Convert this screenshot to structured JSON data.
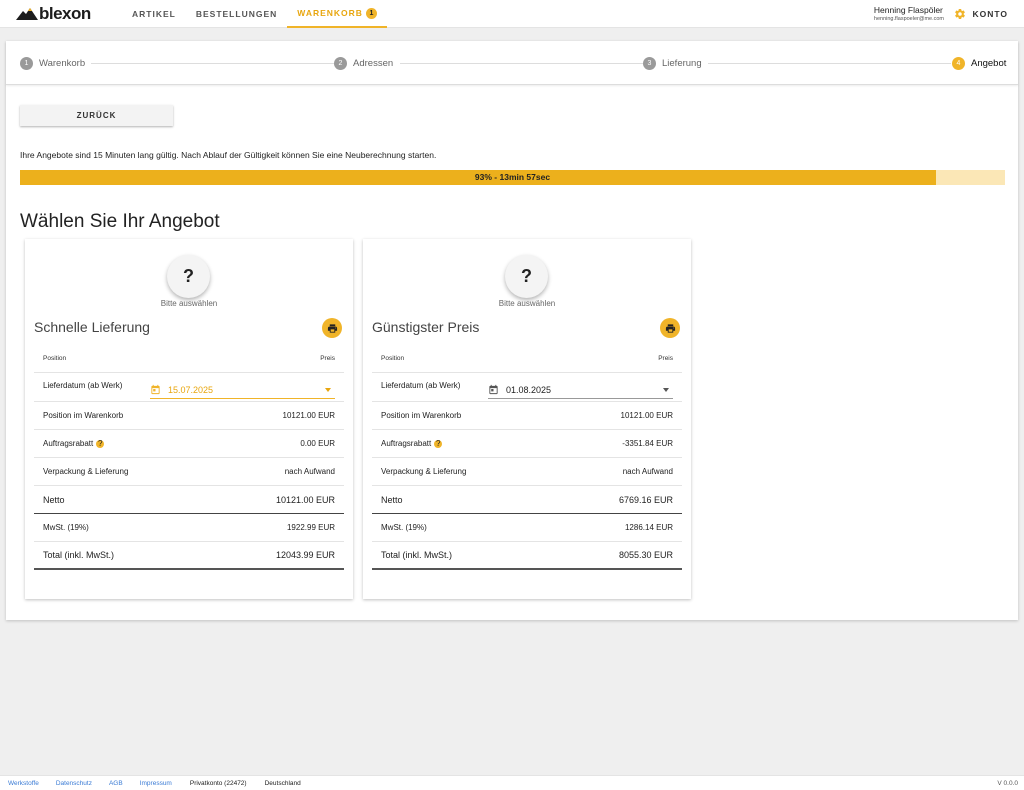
{
  "logo": {
    "text": "blexon"
  },
  "nav": {
    "items": [
      {
        "label": "ARTIKEL"
      },
      {
        "label": "BESTELLUNGEN"
      },
      {
        "label": "WARENKORB",
        "badge": "1"
      }
    ]
  },
  "user": {
    "name": "Henning Flaspöler",
    "email": "henning.flaspoeler@me.com"
  },
  "account": {
    "label": "KONTO",
    "icon": "gear-icon"
  },
  "stepper": {
    "steps": [
      {
        "num": "1",
        "label": "Warenkorb"
      },
      {
        "num": "2",
        "label": "Adressen"
      },
      {
        "num": "3",
        "label": "Lieferung"
      },
      {
        "num": "4",
        "label": "Angebot"
      }
    ],
    "active_step": "4"
  },
  "back_button": {
    "label": "ZURÜCK"
  },
  "info_text": "Ihre Angebote sind 15 Minuten lang gültig. Nach Ablauf der Gültigkeit können Sie eine Neuberechnung starten.",
  "progress": {
    "percent": 93,
    "text": "93% - 13min 57sec"
  },
  "heading": "Wählen Sie Ihr Angebot",
  "offers": [
    {
      "select_symbol": "?",
      "select_label": "Bitte auswählen",
      "title": "Schnelle Lieferung",
      "header_position": "Position",
      "header_price": "Preis",
      "delivery_date_label": "Lieferdatum (ab Werk)",
      "delivery_date": "15.07.2025",
      "rows": [
        {
          "label": "Position im Warenkorb",
          "value": "10121.00 EUR"
        },
        {
          "label": "Auftragsrabatt",
          "value": "0.00 EUR"
        },
        {
          "label": "Verpackung & Lieferung",
          "value": "nach Aufwand"
        }
      ],
      "net_label": "Netto",
      "net_value": "10121.00 EUR",
      "vat_label": "MwSt. (19%)",
      "vat_value": "1922.99 EUR",
      "total_label": "Total (inkl. MwSt.)",
      "total_value": "12043.99 EUR"
    },
    {
      "select_symbol": "?",
      "select_label": "Bitte auswählen",
      "title": "Günstigster Preis",
      "header_position": "Position",
      "header_price": "Preis",
      "delivery_date_label": "Lieferdatum (ab Werk)",
      "delivery_date": "01.08.2025",
      "rows": [
        {
          "label": "Position im Warenkorb",
          "value": "10121.00 EUR"
        },
        {
          "label": "Auftragsrabatt",
          "value": "-3351.84 EUR"
        },
        {
          "label": "Verpackung & Lieferung",
          "value": "nach Aufwand"
        }
      ],
      "net_label": "Netto",
      "net_value": "6769.16 EUR",
      "vat_label": "MwSt. (19%)",
      "vat_value": "1286.14 EUR",
      "total_label": "Total (inkl. MwSt.)",
      "total_value": "8055.30 EUR"
    }
  ],
  "footer": {
    "links": [
      "Werkstoffe",
      "Datenschutz",
      "AGB",
      "Impressum"
    ],
    "account": "Privatkonto (22472)",
    "country": "Deutschland",
    "version": "V 0.0.0"
  },
  "colors": {
    "accent": "#f0b429",
    "progress_fill": "#ecb01c",
    "progress_track": "#fbe7b6",
    "link": "#3a7bd5"
  }
}
